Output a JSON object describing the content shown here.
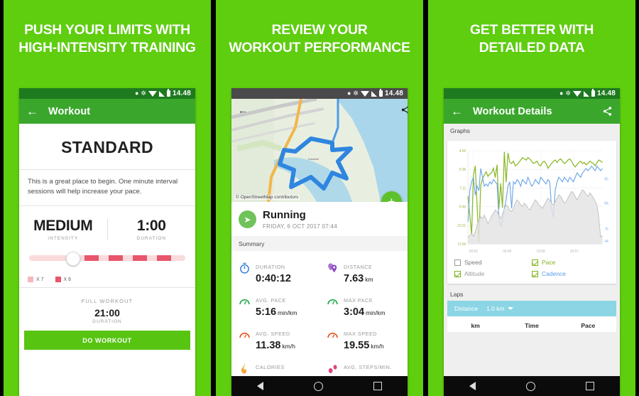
{
  "theme": {
    "bg_green": "#5ECE0E",
    "app_green": "#3AA62C",
    "status_green": "#1E7A1E",
    "accent_button": "#58C412",
    "laps_blue": "#8BD5E5"
  },
  "panels": [
    {
      "headline_line1": "PUSH YOUR LIMITS WITH",
      "headline_line2": "HIGH-INTENSITY TRAINING",
      "status": {
        "clock": "14.48",
        "icons": [
          "location-icon",
          "bluetooth-icon",
          "wifi-icon",
          "signal-icon",
          "battery-icon"
        ]
      },
      "appbar": {
        "back": "←",
        "title": "Workout"
      },
      "workout": {
        "name": "STANDARD",
        "description": "This is a great place to begin. One minute interval sessions will help increase your pace.",
        "intensity_value": "MEDIUM",
        "intensity_label": "INTENSITY",
        "duration_value": "1:00",
        "duration_label": "DURATION",
        "legend": [
          {
            "label": "X 7",
            "color": "#F5B8BF"
          },
          {
            "label": "X 6",
            "color": "#E8566B"
          }
        ],
        "full_workout_label": "FULL WORKOUT",
        "full_workout_value": "21:00",
        "full_workout_unit": "DURATION",
        "cta": "DO WORKOUT"
      }
    },
    {
      "headline_line1": "REVIEW YOUR",
      "headline_line2": "WORKOUT PERFORMANCE",
      "status": {
        "clock": "14.48"
      },
      "map": {
        "attribution": "© OpenStreetMap contributors",
        "fab": "+",
        "back_icon": "back-arrow-icon",
        "share_icon": "share-icon"
      },
      "activity": {
        "name": "Running",
        "date": "FRIDAY, 6 OCT 2017 07:44",
        "icon": "running-shoe-icon"
      },
      "summary_header": "Summary",
      "summary": [
        {
          "key": "DURATION",
          "value": "0:40:12",
          "unit": "",
          "icon": "stopwatch-icon",
          "color": "#2E7BD6"
        },
        {
          "key": "DISTANCE",
          "value": "7.63",
          "unit": "km",
          "icon": "map-pin-icon",
          "color": "#8E44C4"
        },
        {
          "key": "AVG. PACE",
          "value": "5:16",
          "unit": "min/km",
          "icon": "gauge-icon",
          "color": "#1FA84B"
        },
        {
          "key": "MAX PACE",
          "value": "3:04",
          "unit": "min/km",
          "icon": "gauge-icon",
          "color": "#1FA84B"
        },
        {
          "key": "AVG. SPEED",
          "value": "11.38",
          "unit": "km/h",
          "icon": "gauge-icon",
          "color": "#E8541E"
        },
        {
          "key": "MAX SPEED",
          "value": "19.55",
          "unit": "km/h",
          "icon": "gauge-icon",
          "color": "#E8541E"
        },
        {
          "key": "CALORIES",
          "value": "",
          "unit": "",
          "icon": "flame-icon",
          "color": "#F2A93B"
        },
        {
          "key": "AVG. STEPS/MIN.",
          "value": "",
          "unit": "",
          "icon": "steps-icon",
          "color": "#E0437F"
        }
      ]
    },
    {
      "headline_line1": "GET BETTER WITH",
      "headline_line2": "DETAILED DATA",
      "status": {
        "clock": "14.48"
      },
      "appbar": {
        "back": "←",
        "title": "Workout Details",
        "share_icon": "share-icon"
      },
      "graphs_header": "Graphs",
      "legend": [
        {
          "label": "Speed",
          "checked": false,
          "color": "#7a7a7a"
        },
        {
          "label": "Pace",
          "checked": true,
          "color": "#7FB41E"
        },
        {
          "label": "Altitude",
          "checked": true,
          "color": "#9a9a9a"
        },
        {
          "label": "Cadence",
          "checked": true,
          "color": "#5B9BE8"
        }
      ],
      "laps_header": "Laps",
      "laps_filter_label": "Distance",
      "laps_filter_value": "1.0 km",
      "laps_columns": [
        "km",
        "Time",
        "Pace"
      ]
    }
  ],
  "chart_data": {
    "type": "line",
    "title": "Graphs",
    "xlabel": "",
    "ylabel": "",
    "x_ticks": [
      "00:00",
      "09:09",
      "19:58",
      "29:57"
    ],
    "y_left_ticks": [
      "4:00",
      "5:36",
      "7:11",
      "8:46",
      "10:21",
      "11:56"
    ],
    "y_right_ticks": [
      "85",
      "84",
      "76",
      "44"
    ],
    "grid": true,
    "legend_position": "below",
    "series": [
      {
        "name": "Pace",
        "color": "#8CB82A",
        "axis": "left",
        "values": [
          7.9,
          9.5,
          11.2,
          6.1,
          5.3,
          8.6,
          11.9,
          7.0,
          6.4,
          6.1,
          5.8,
          6.2,
          6.0,
          5.9,
          5.5,
          6.3,
          5.2,
          9.0,
          6.8,
          8.9,
          4.1,
          6.7,
          4.2,
          5.0,
          5.1,
          4.9,
          5.3,
          5.2,
          5.0,
          4.8,
          4.6,
          4.7,
          4.8,
          4.6,
          4.7,
          4.9,
          5.1,
          5.0,
          4.9,
          5.2,
          5.3,
          5.0,
          4.9,
          5.1,
          5.5,
          5.3,
          5.1,
          4.9,
          4.8,
          5.0,
          4.8,
          4.7,
          4.9,
          5.1,
          5.0,
          4.8,
          4.7,
          4.9,
          5.2,
          5.4,
          5.2,
          5.0,
          4.9,
          5.1,
          5.0,
          5.2,
          5.1,
          4.9,
          5.0,
          5.1,
          5.3,
          5.0,
          4.8,
          4.9,
          5.0
        ]
      },
      {
        "name": "Cadence",
        "color": "#6FA8E8",
        "axis": "right",
        "values": [
          60,
          74,
          78,
          80,
          72,
          76,
          74,
          84,
          80,
          76,
          77,
          76,
          78,
          77,
          79,
          78,
          77,
          62,
          58,
          60,
          66,
          70,
          76,
          78,
          66,
          78,
          77,
          79,
          78,
          76,
          79,
          78,
          77,
          80,
          78,
          76,
          77,
          79,
          78,
          77,
          80,
          79,
          78,
          77,
          79,
          78,
          66,
          62,
          74,
          78,
          80,
          79,
          78,
          80,
          79,
          78,
          80,
          79,
          78,
          80,
          82,
          81,
          80,
          82,
          83,
          84,
          83,
          84,
          85,
          84,
          83,
          85,
          84,
          83,
          84
        ]
      },
      {
        "name": "Altitude",
        "color": "#BEBEBE",
        "axis": "right",
        "fill": true,
        "values": [
          8,
          10,
          12,
          9,
          14,
          22,
          28,
          32,
          30,
          34,
          29,
          24,
          28,
          33,
          36,
          40,
          38,
          34,
          30,
          35,
          42,
          46,
          44,
          40,
          38,
          42,
          48,
          52,
          50,
          46,
          44,
          48,
          46,
          42,
          40,
          44,
          48,
          52,
          50,
          46,
          44,
          42,
          46,
          50,
          54,
          52,
          48,
          46,
          50,
          54,
          58,
          56,
          52,
          48,
          50,
          54,
          58,
          62,
          60,
          56,
          52,
          56,
          60,
          64,
          62,
          58,
          56,
          60,
          58,
          54,
          50,
          46,
          30,
          8,
          10
        ]
      }
    ]
  },
  "android_nav": {
    "back": "nav-back-icon",
    "home": "nav-home-icon",
    "recents": "nav-recents-icon"
  }
}
